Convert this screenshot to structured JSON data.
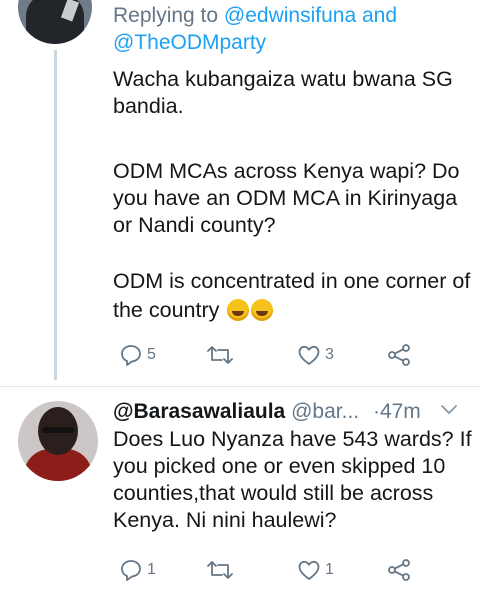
{
  "tweet1": {
    "replying_prefix": "Replying to",
    "mentions": [
      "@edwinsifuna",
      "@TheODMparty"
    ],
    "and_word": "and",
    "paragraphs": [
      "Wacha kubangaiza watu bwana SG bandia.",
      "ODM MCAs across Kenya wapi? Do you have an ODM MCA in Kirinyaga or Nandi county?",
      "ODM is concentrated in one corner of the country"
    ],
    "emoji": [
      "rolling-on-floor-laughing",
      "rolling-on-floor-laughing"
    ],
    "actions": {
      "reply_count": "5",
      "retweet_count": "",
      "like_count": "3"
    }
  },
  "tweet2": {
    "display_name": "@Barasawaliaula",
    "handle": "@bar...",
    "separator": "·",
    "time": "47m",
    "text": "Does Luo Nyanza have 543 wards? If you picked one or even skipped 10 counties,that would still be across Kenya. Ni nini haulewi?",
    "actions": {
      "reply_count": "1",
      "retweet_count": "",
      "like_count": "1"
    }
  },
  "colors": {
    "accent": "#1da1f2",
    "secondary_text": "#657786",
    "primary_text": "#14171a",
    "thread_line": "#ccd6dd"
  }
}
